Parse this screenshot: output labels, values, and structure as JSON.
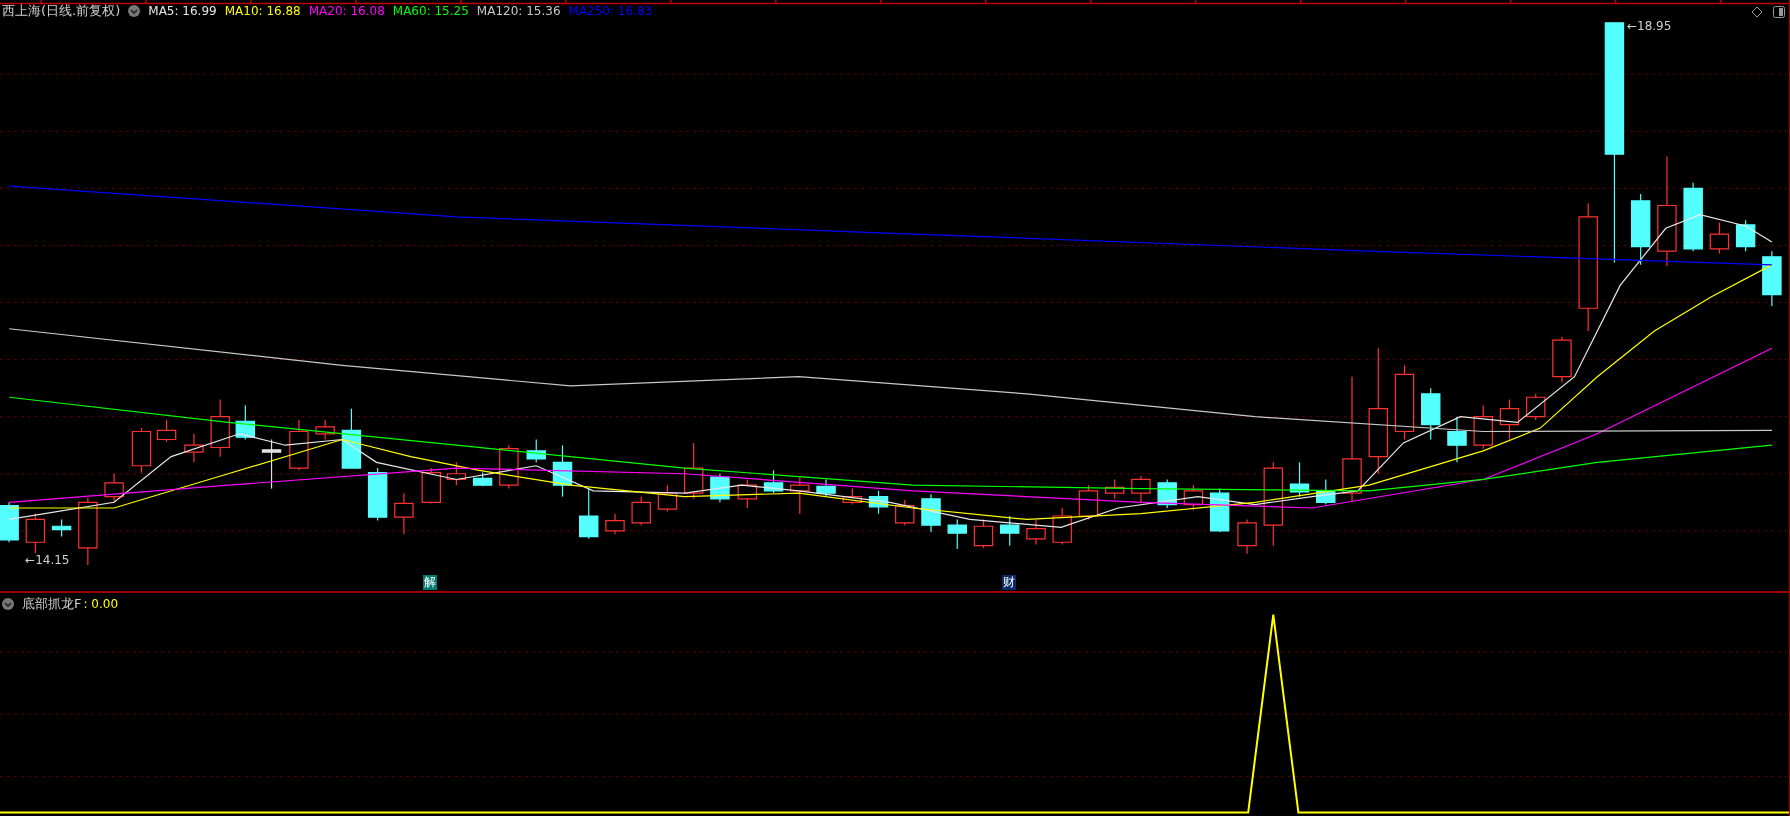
{
  "header": {
    "title": "西上海(日线.前复权)",
    "indicators": [
      {
        "label": "MA5: 16.99",
        "color": "#e8e8e8"
      },
      {
        "label": "MA10: 16.88",
        "color": "#ffff00"
      },
      {
        "label": "MA20: 16.08",
        "color": "#ff00ff"
      },
      {
        "label": "MA60: 15.25",
        "color": "#00ff00"
      },
      {
        "label": "MA120: 15.36",
        "color": "#c8c8c8"
      },
      {
        "label": "MA250: 16.83",
        "color": "#0000ff"
      }
    ]
  },
  "price_marks": [
    {
      "text": "←18.95",
      "kind": "high"
    },
    {
      "text": "←14.15",
      "kind": "low"
    }
  ],
  "event_badges": [
    {
      "text": "解",
      "color": "#007a70"
    },
    {
      "text": "财",
      "color": "#0a2a6a"
    }
  ],
  "indicator_panel": {
    "name": "底部抓龙F",
    "value_text": ": 0.00"
  }
}
